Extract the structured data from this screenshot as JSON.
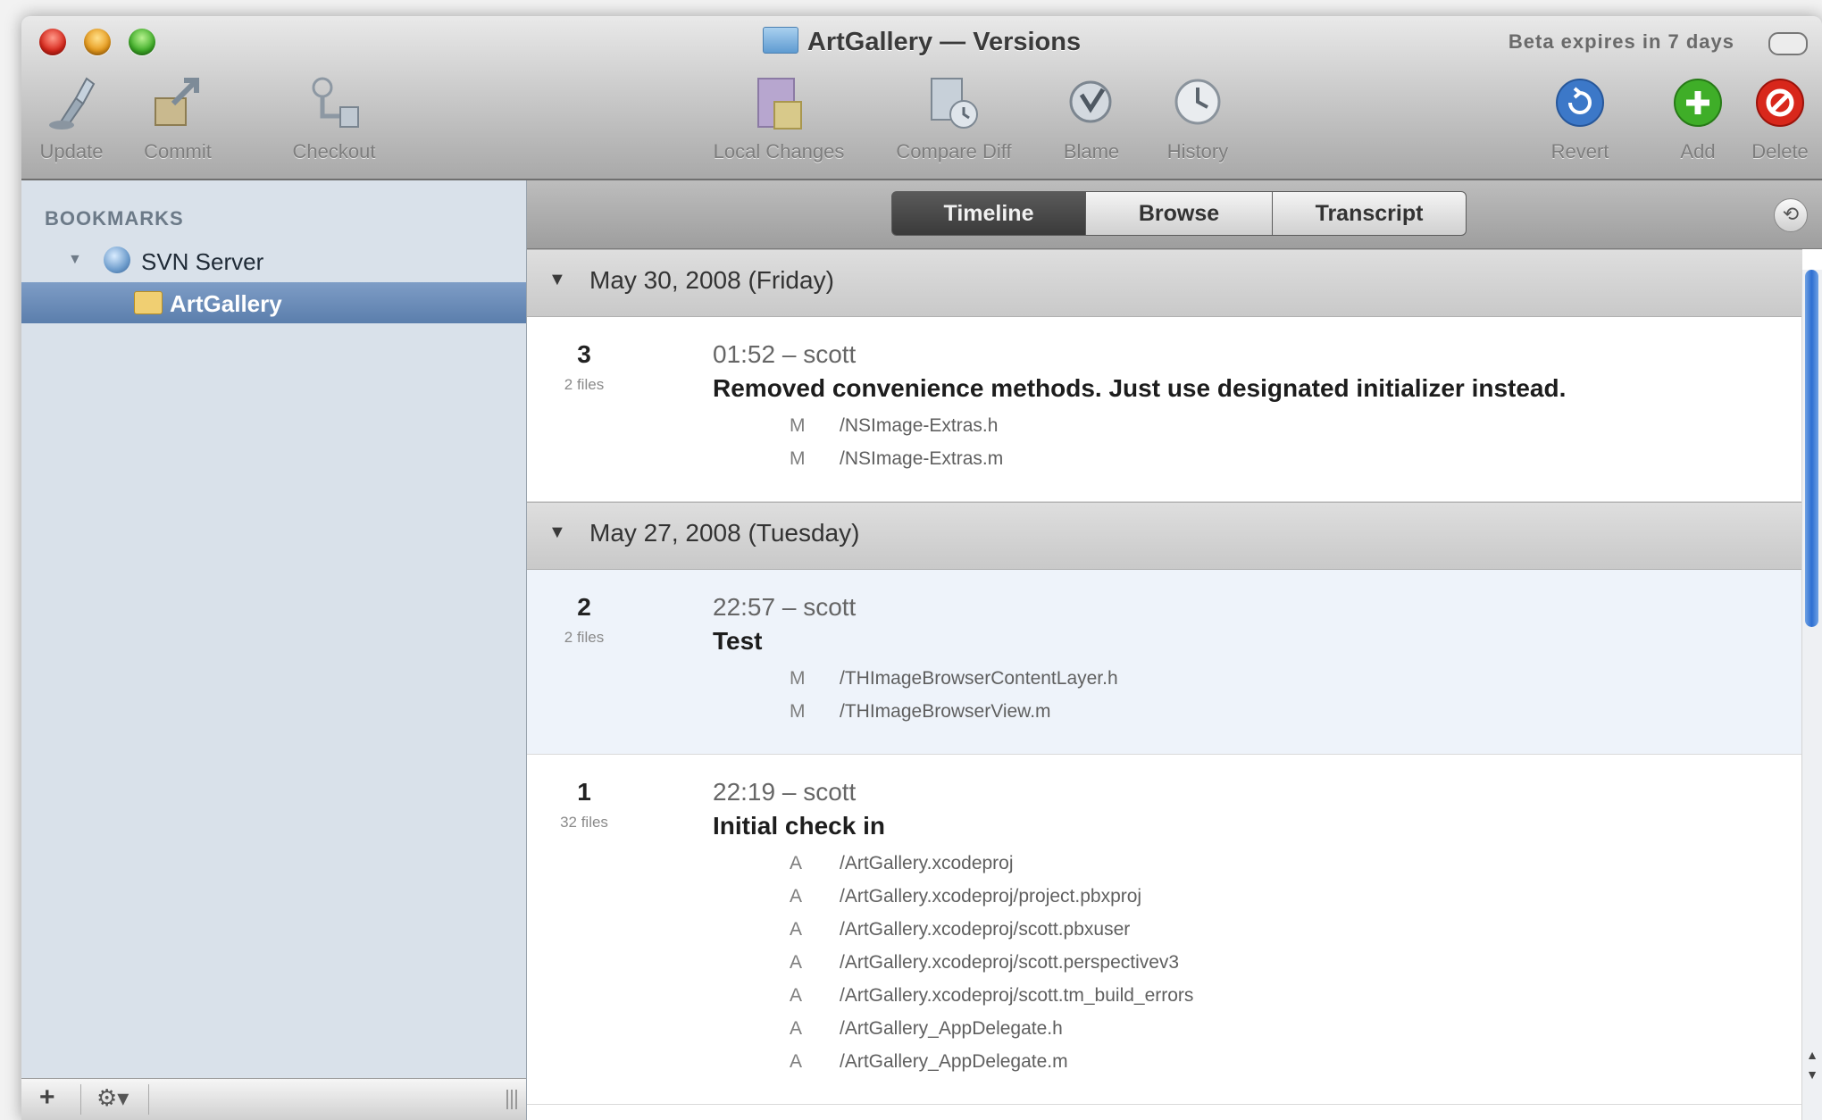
{
  "window": {
    "title": "ArtGallery — Versions",
    "beta_notice": "Beta expires in 7 days"
  },
  "toolbar": {
    "update": "Update",
    "commit": "Commit",
    "checkout": "Checkout",
    "local_changes": "Local Changes",
    "compare_diff": "Compare Diff",
    "blame": "Blame",
    "history": "History",
    "revert": "Revert",
    "add": "Add",
    "delete": "Delete"
  },
  "sidebar": {
    "heading": "BOOKMARKS",
    "server": "SVN Server",
    "repository": "ArtGallery"
  },
  "tabs": {
    "timeline": "Timeline",
    "browse": "Browse",
    "transcript": "Transcript",
    "active": "Timeline"
  },
  "timeline": {
    "days": [
      {
        "date": "May 30, 2008 (Friday)",
        "commits": [
          {
            "rev": "3",
            "files": "2 files",
            "time": "01:52 – scott",
            "message": "Removed convenience methods. Just use designated initializer instead.",
            "paths": [
              {
                "status": "M",
                "path": "/NSImage-Extras.h"
              },
              {
                "status": "M",
                "path": "/NSImage-Extras.m"
              }
            ]
          }
        ]
      },
      {
        "date": "May 27, 2008 (Tuesday)",
        "commits": [
          {
            "rev": "2",
            "files": "2 files",
            "time": "22:57 – scott",
            "message": "Test",
            "paths": [
              {
                "status": "M",
                "path": "/THImageBrowserContentLayer.h"
              },
              {
                "status": "M",
                "path": "/THImageBrowserView.m"
              }
            ]
          },
          {
            "rev": "1",
            "files": "32 files",
            "time": "22:19 – scott",
            "message": "Initial check in",
            "paths": [
              {
                "status": "A",
                "path": "/ArtGallery.xcodeproj"
              },
              {
                "status": "A",
                "path": "/ArtGallery.xcodeproj/project.pbxproj"
              },
              {
                "status": "A",
                "path": "/ArtGallery.xcodeproj/scott.pbxuser"
              },
              {
                "status": "A",
                "path": "/ArtGallery.xcodeproj/scott.perspectivev3"
              },
              {
                "status": "A",
                "path": "/ArtGallery.xcodeproj/scott.tm_build_errors"
              },
              {
                "status": "A",
                "path": "/ArtGallery_AppDelegate.h"
              },
              {
                "status": "A",
                "path": "/ArtGallery_AppDelegate.m"
              }
            ]
          }
        ]
      }
    ]
  },
  "colors": {
    "selection": "#5b7eac",
    "add_green": "#3fae28",
    "delete_red": "#d8271b",
    "revert_blue": "#3c78c8"
  }
}
